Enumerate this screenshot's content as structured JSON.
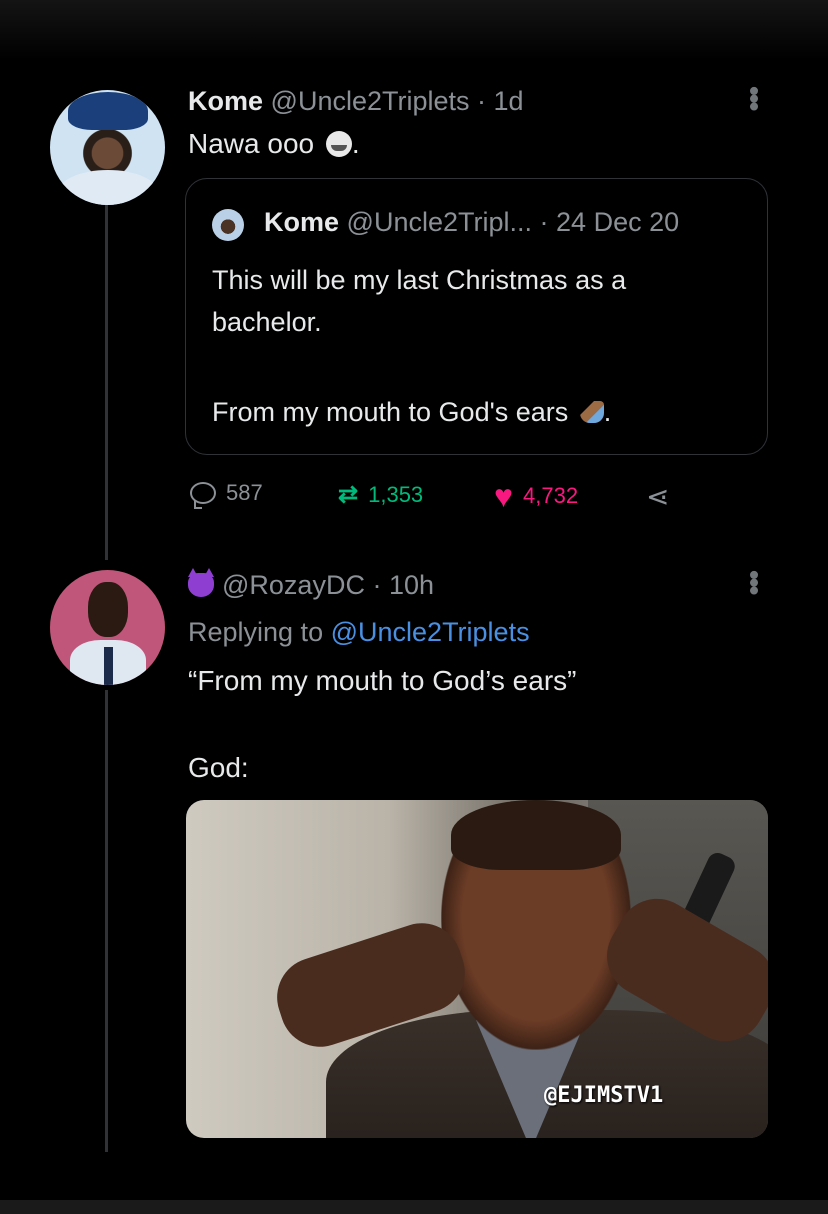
{
  "tweet1": {
    "name": "Kome",
    "handle": "@Uncle2Triplets",
    "separator": "·",
    "time": "1d",
    "text": "Nawa ooo",
    "text_end": ".",
    "more": "⋮"
  },
  "quote": {
    "name": "Kome",
    "handle": "@Uncle2Tripl...",
    "separator": "·",
    "date": "24 Dec 20",
    "line1": "This will be my last Christmas as a",
    "line2": "bachelor.",
    "line3": "From my mouth to God's ears",
    "line3_end": "."
  },
  "actions": {
    "replies": "587",
    "retweets": "1,353",
    "likes": "4,732",
    "colors": {
      "retweet": "#00ba7c",
      "like": "#f91880",
      "muted": "#8b9196"
    }
  },
  "tweet2": {
    "handle": "@RozayDC",
    "separator": "·",
    "time": "10h",
    "replying_prefix": "Replying to",
    "replying_handle": "@Uncle2Triplets",
    "quote_line": "“From my mouth to God’s ears”",
    "god_line": "God:",
    "more": "⋮"
  },
  "media": {
    "watermark": "@EJIMSTV1"
  },
  "icons": {
    "reply": "reply-icon",
    "retweet": "retweet-icon",
    "like": "heart-icon",
    "share": "share-icon"
  }
}
